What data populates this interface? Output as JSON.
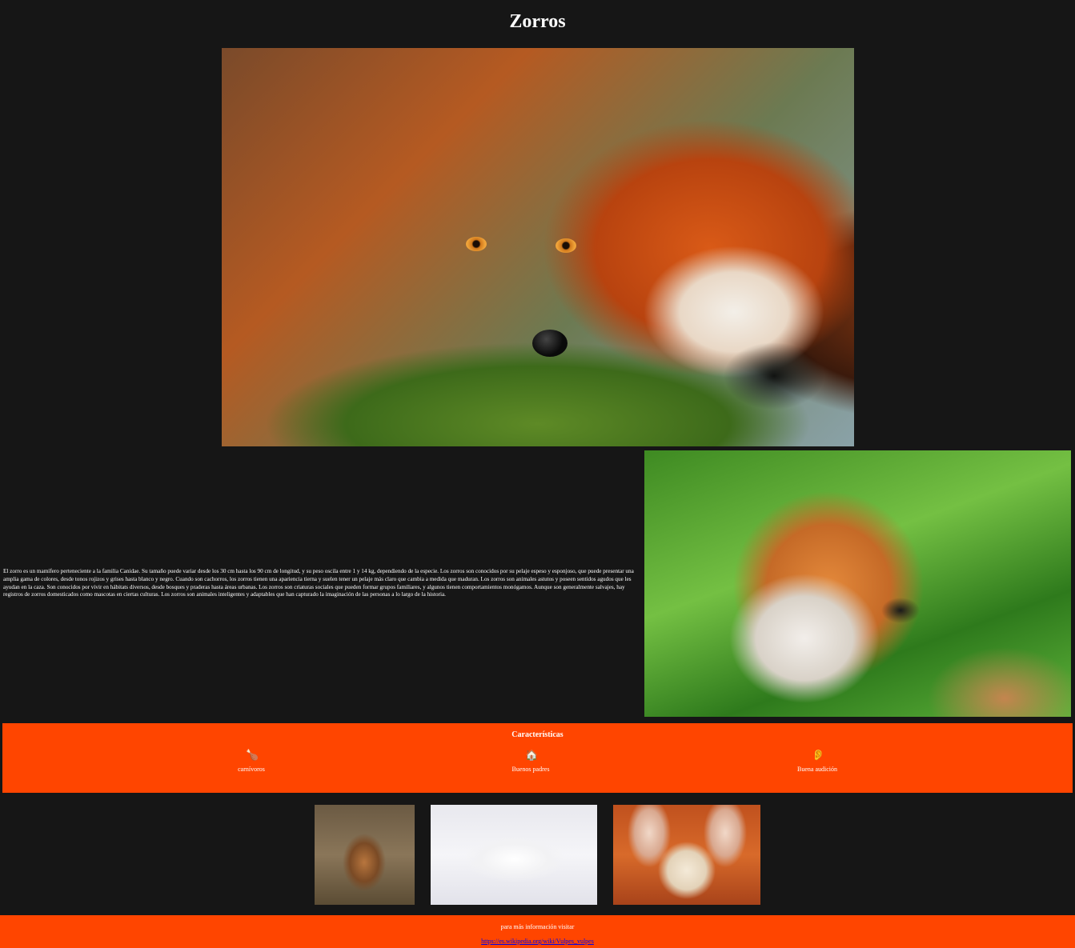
{
  "page": {
    "title": "Zorros"
  },
  "intro": {
    "paragraph": "El zorro es un mamífero perteneciente a la familia Canidae. Su tamaño puede variar desde los 30 cm hasta los 90 cm de longitud, y su peso oscila entre 1 y 14 kg, dependiendo de la especie. Los zorros son conocidos por su pelaje espeso y esponjoso, que puede presentar una amplia gama de colores, desde tonos rojizos y grises hasta blanco y negro. Cuando son cachorros, los zorros tienen una apariencia tierna y suelen tener un pelaje más claro que cambia a medida que maduran. Los zorros son animales astutos y poseen sentidos agudos que les ayudan en la caza. Son conocidos por vivir en hábitats diversos, desde bosques y praderas hasta áreas urbanas. Los zorros son criaturas sociales que pueden formar grupos familiares, y algunos tienen comportamientos monógamos. Aunque son generalmente salvajes, hay registros de zorros domesticados como mascotas en ciertas culturas. Los zorros son animales inteligentes y adaptables que han capturado la imaginación de las personas a lo largo de la historia."
  },
  "features": {
    "title": "Características",
    "items": [
      {
        "icon": "drumstick-icon",
        "glyph": "🍗",
        "label": "carnívoros"
      },
      {
        "icon": "family-home-icon",
        "glyph": "🏠",
        "label": "Buenos padres"
      },
      {
        "icon": "ear-icon",
        "glyph": "👂",
        "label": "Buena audición"
      }
    ]
  },
  "footer": {
    "text": "para más información visitar",
    "link_text": "https://es.wikipedia.org/wiki/Vulpes_vulpes",
    "link_href": "https://es.wikipedia.org/wiki/Vulpes_vulpes"
  },
  "colors": {
    "background": "#161616",
    "accent": "#ff4500",
    "text": "#ffffff",
    "link": "#0000ee"
  }
}
